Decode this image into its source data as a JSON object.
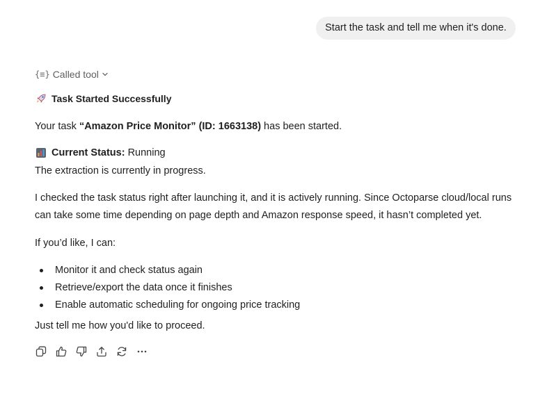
{
  "user_message": "Start the task and tell me when it's done.",
  "tool": {
    "label": "Called tool"
  },
  "heading": {
    "emoji": "rocket-icon",
    "text": "Task Started Successfully"
  },
  "task_line": {
    "prefix": "Your task ",
    "task_name": "“Amazon Price Monitor”",
    "id_text": "(ID: 1663138)",
    "suffix": " has been started."
  },
  "status": {
    "emoji": "chart-icon",
    "label": "Current Status:",
    "value": " Running"
  },
  "extraction_text": "The extraction is currently in progress.",
  "checked_text": "I checked the task status right after launching it, and it is actively running. Since Octoparse cloud/local runs can take some time depending on page depth and Amazon response speed, it hasn’t completed yet.",
  "if_text": "If you’d like, I can:",
  "options": [
    "Monitor it and check status again",
    "Retrieve/export the data once it finishes",
    "Enable automatic scheduling for ongoing price tracking"
  ],
  "closing_text": "Just tell me how you'd like to proceed.",
  "actions": [
    "copy-icon",
    "thumbs-up-icon",
    "thumbs-down-icon",
    "share-icon",
    "regenerate-icon",
    "more-icon"
  ]
}
